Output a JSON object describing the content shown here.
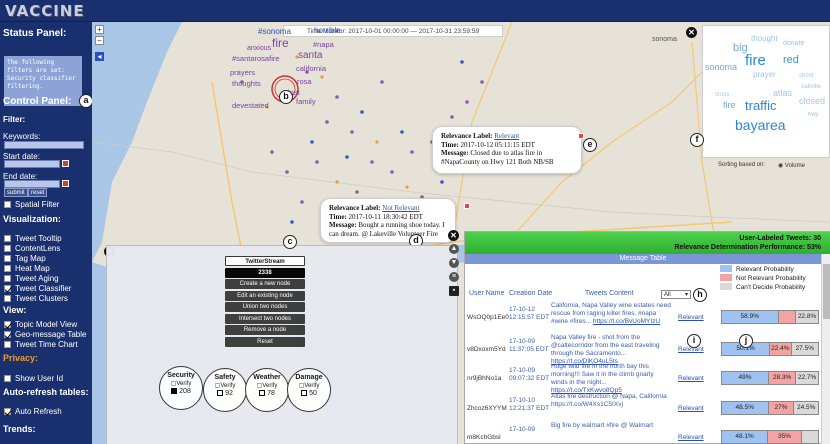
{
  "app": {
    "logo": "VACCINE"
  },
  "sidebar": {
    "status_title": "Status Panel:",
    "status_text": "The following filters are set: Security classifier filtering.",
    "control_title": "Control Panel:",
    "filter_title": "Filter:",
    "keywords_label": "Keywords:",
    "start_label": "Start date:",
    "end_label": "End date:",
    "submit_label": "submit",
    "reset_label": "reset",
    "spatial_filter": "Spatial Filter",
    "viz_title": "Visualization:",
    "viz_items": [
      {
        "label": "Tweet Tooltip",
        "checked": false
      },
      {
        "label": "ContentLens",
        "checked": false
      },
      {
        "label": "Tag Map",
        "checked": false
      },
      {
        "label": "Heat Map",
        "checked": false
      },
      {
        "label": "Tweet Aging",
        "checked": false
      },
      {
        "label": "Tweet Classifier",
        "checked": true
      },
      {
        "label": "Tweet Clusters",
        "checked": false
      }
    ],
    "view_title": "View:",
    "view_items": [
      {
        "label": "Topic Model View",
        "checked": true
      },
      {
        "label": "Geo-message Table",
        "checked": true
      },
      {
        "label": "Tweet Time Chart",
        "checked": false
      }
    ],
    "privacy_title": "Privacy:",
    "privacy_item": "Show User Id",
    "autorefresh_title": "Auto-refresh tables:",
    "autorefresh_item": "Auto Refresh",
    "trends_title": "Trends:"
  },
  "map": {
    "time_monitor": "Time Monitor:    2017-10-01 00:00:00 — 2017-10-31 23:59:59",
    "zoom_in": "+",
    "zoom_out": "−",
    "tag_words": [
      "#sonoma",
      "fire",
      "horrible",
      "anxious",
      "#napa",
      "santa",
      "#santarosafire",
      "california",
      "prayers",
      "thoughts",
      "rosa",
      "devestated",
      "lost",
      "family",
      "sonoma"
    ],
    "labels": [
      "a",
      "b",
      "c",
      "d",
      "e",
      "f",
      "g",
      "h",
      "i",
      "j"
    ]
  },
  "wordcloud": {
    "words": [
      "big",
      "thought",
      "donate",
      "fire",
      "red",
      "sonoma",
      "prayer",
      "shoot",
      "cross",
      "atlas",
      "oakville",
      "closed",
      "fire",
      "traffic",
      "hwy",
      "bayarea"
    ],
    "sort_label": "Sorting based on:",
    "sort_option": "Volume"
  },
  "popup1": {
    "label_key": "Relevance Label:",
    "label_val": "Relevant",
    "time_key": "Time:",
    "time_val": "2017-10-12 05:11:15 EDT",
    "msg_key": "Message:",
    "msg_val": "Closed due to atlas fire in #NapaCounty on Hwy 121 Both NB/SB"
  },
  "popup2": {
    "label_key": "Relevance Label:",
    "label_val": "Not Relevant",
    "time_key": "Time:",
    "time_val": "2017-10-11 18:30:42 EDT",
    "msg_key": "Message:",
    "msg_val": "Bought a running shoe today. I can dream. @ Lakeville Volunteer Fire"
  },
  "twitterstream": {
    "title": "TwitterStream",
    "count": "2338",
    "actions": [
      "Create a new node",
      "Edit an existing node",
      "Union two nodes",
      "Intersect two nodes",
      "Remove a node",
      "Reset"
    ],
    "topics": [
      {
        "name": "Security",
        "verify": "Verify",
        "count": "208",
        "filled": true
      },
      {
        "name": "Safety",
        "verify": "Verify",
        "count": "92",
        "filled": false
      },
      {
        "name": "Weather",
        "verify": "Verify",
        "count": "78",
        "filled": false
      },
      {
        "name": "Damage",
        "verify": "Verify",
        "count": "50",
        "filled": false
      }
    ]
  },
  "table": {
    "user_labeled": "User-Labeled Tweets: 30",
    "performance": "Relevance Determination Performance: 53%",
    "title": "Message Table",
    "legend": [
      {
        "label": "Relevant Probability",
        "color": "#9fc2f0"
      },
      {
        "label": "Not Relevant Probability",
        "color": "#f4a3a3"
      },
      {
        "label": "Can't Decide Probability",
        "color": "#d9d9d9"
      }
    ],
    "headers": {
      "user": "User Name",
      "date": "Creation Date",
      "content": "Tweets Content"
    },
    "filter_value": "All",
    "rows": [
      {
        "user": "WsOQ0p1Ee0",
        "date1": "17-10-12",
        "date2": "12:15:57 EDT",
        "content": "California, Napa Valley wine estates need rescue from raging killer fires. #napa #wine #fires...",
        "link": "https://t.co/BvUoMYIzU",
        "label": "Relevant",
        "p1": "58.9%",
        "p2": "",
        "p3": "22.8%",
        "v1": 58.9,
        "v2": 18.3,
        "v3": 22.8
      },
      {
        "user": "v8Dxoxm5Yd",
        "date1": "17-10-09",
        "date2": "11:37:05 EDT",
        "content": "Napa Valley fire - shot from the @caltecorridor from the east traveling through the Sacramento...",
        "link": "https://t.co/DlKO4uL5ts",
        "label": "Relevant",
        "p1": "50.1%",
        "p2": "22.4%",
        "p3": "27.5%",
        "v1": 50.1,
        "v2": 22.4,
        "v3": 27.5
      },
      {
        "user": "nr9jBhNo1a",
        "date1": "17-10-09",
        "date2": "09:07:32 EDT",
        "content": "Huge wild fire in the north bay this morning!!! Saw it in the climb gnarly winds in the night...",
        "link": "https://t.co/TxKwvo8Qp5",
        "label": "Relevant",
        "p1": "49%",
        "p2": "28.3%",
        "p3": "22.7%",
        "v1": 49,
        "v2": 28.3,
        "v3": 22.7
      },
      {
        "user": "Zhcoz6XYYM",
        "date1": "17-10-10",
        "date2": "12:21:37 EDT",
        "content": "Atlas fire destruction @ Napa, California https://t.co/W4Xs1C5IXvj",
        "link": "",
        "label": "Relevant",
        "p1": "48.5%",
        "p2": "27%",
        "p3": "24.5%",
        "v1": 48.5,
        "v2": 27,
        "v3": 24.5
      },
      {
        "user": "m8KchGbsl",
        "date1": "17-10-09",
        "date2": "",
        "content": "Big fire by walmart #fire @ Walmart",
        "link": "",
        "label": "Relevant",
        "p1": "48.1%",
        "p2": "35%",
        "p3": "",
        "v1": 48.1,
        "v2": 35,
        "v3": 16.9
      }
    ]
  }
}
